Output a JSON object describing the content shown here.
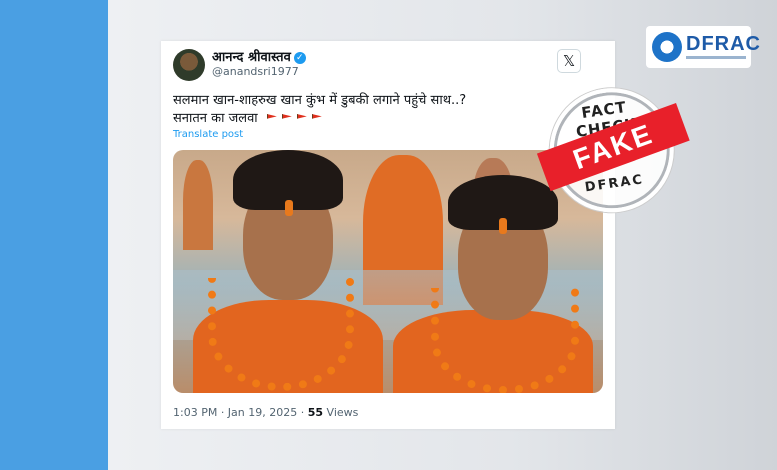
{
  "tweet": {
    "author_name": "आनन्द श्रीवास्तव",
    "verified_mark": "✓",
    "handle": "@anandsri1977",
    "text_line1": "सलमान खान-शाहरुख खान कुंभ में डुबकी लगाने पहुंचे साथ..?",
    "text_line2": "सनातन का जलवा",
    "translate_label": "Translate post",
    "timestamp": "1:03 PM · Jan 19, 2025 · ",
    "views_count": "55",
    "views_label": " Views",
    "x_logo_glyph": "𝕏"
  },
  "stamp": {
    "top_text": "FACT CHECK",
    "band_text": "FAKE",
    "bottom_text": "DFRAC",
    "band_color": "#e8202a"
  },
  "logo": {
    "text": "DFRAC",
    "color": "#1e5ba8"
  },
  "colors": {
    "left_strip": "#4a9fe3",
    "link": "#1d9bf0"
  }
}
